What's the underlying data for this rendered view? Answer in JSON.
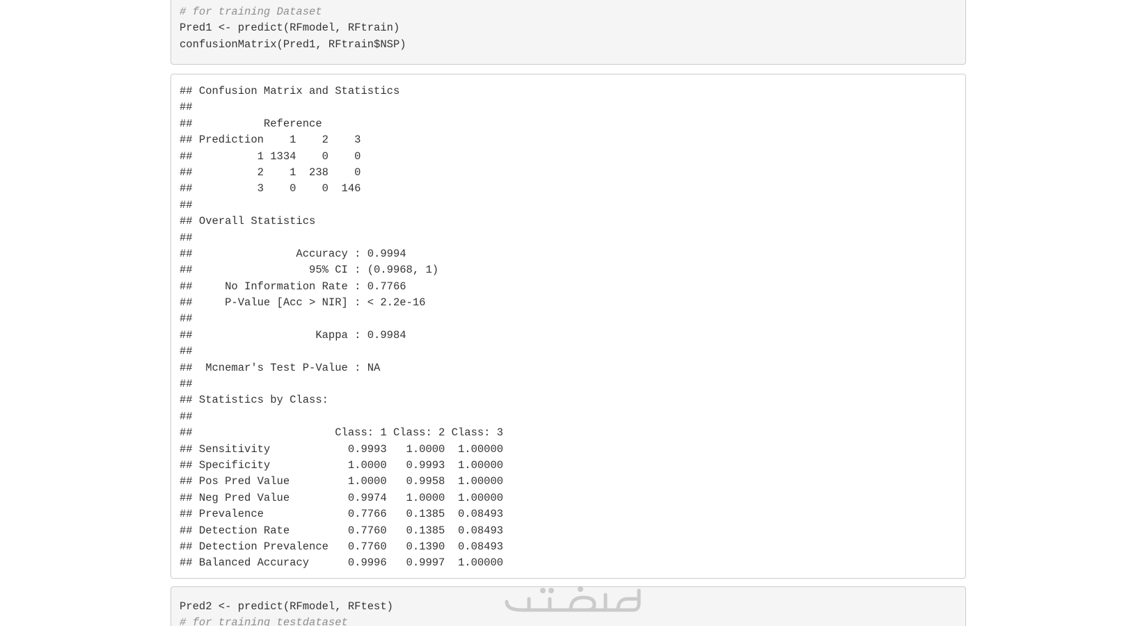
{
  "code_block_1": {
    "lines": [
      {
        "text": "# for training Dataset",
        "comment": true
      },
      {
        "text": "Pred1 <- predict(RFmodel, RFtrain)",
        "comment": false
      },
      {
        "text": "confusionMatrix(Pred1, RFtrain$NSP)",
        "comment": false
      }
    ]
  },
  "output_block_1": {
    "lines": [
      "## Confusion Matrix and Statistics",
      "## ",
      "##           Reference",
      "## Prediction    1    2    3",
      "##          1 1334    0    0",
      "##          2    1  238    0",
      "##          3    0    0  146",
      "## ",
      "## Overall Statistics",
      "##                                           ",
      "##                Accuracy : 0.9994          ",
      "##                  95% CI : (0.9968, 1)     ",
      "##     No Information Rate : 0.7766          ",
      "##     P-Value [Acc > NIR] : < 2.2e-16       ",
      "##                                           ",
      "##                   Kappa : 0.9984          ",
      "##                                           ",
      "##  Mcnemar's Test P-Value : NA              ",
      "## ",
      "## Statistics by Class:",
      "## ",
      "##                      Class: 1 Class: 2 Class: 3",
      "## Sensitivity            0.9993   1.0000  1.00000",
      "## Specificity            1.0000   0.9993  1.00000",
      "## Pos Pred Value         1.0000   0.9958  1.00000",
      "## Neg Pred Value         0.9974   1.0000  1.00000",
      "## Prevalence             0.7766   0.1385  0.08493",
      "## Detection Rate         0.7760   0.1385  0.08493",
      "## Detection Prevalence   0.7760   0.1390  0.08493",
      "## Balanced Accuracy      0.9996   0.9997  1.00000"
    ]
  },
  "code_block_2": {
    "lines": [
      {
        "text": "Pred2 <- predict(RFmodel, RFtest)",
        "comment": false
      },
      {
        "text": "# for training testdataset",
        "comment": true
      }
    ]
  },
  "watermark": {
    "text": "خمسات",
    "color": "#9a9a9a"
  },
  "colors": {
    "code_background": "#f5f5f5",
    "border": "#cccccc",
    "text": "#333333",
    "comment": "#8e908c"
  }
}
